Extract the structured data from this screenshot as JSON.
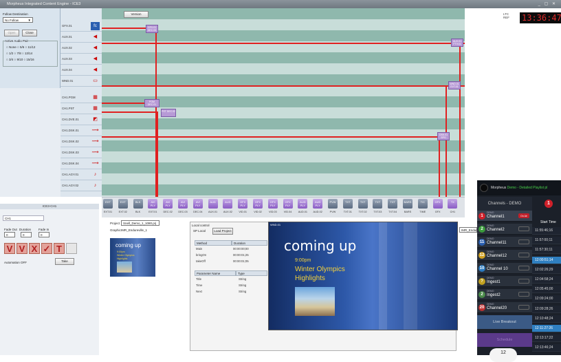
{
  "title_bar": "Morpheus Integrated Content Engine - ICE3",
  "window_buttons": "_ ▢ ✕",
  "follow": {
    "label": "Follow Destination",
    "value": "No Follow",
    "open": "Open",
    "close": "Close"
  },
  "audio_pair": {
    "label": "Active Audio Pair",
    "row1": "○ None ○ 5/6 ○ 11/12",
    "row2": "○ 1/2 ○ 7/8 ○ 13/14",
    "row3": "○ 3/4 ○ 9/10 ○ 15/16"
  },
  "version_button": "Version",
  "timecode": {
    "ltc": "LTC",
    "ref": "REF",
    "value": "13:36:47"
  },
  "rows": [
    {
      "label": "GFX.01",
      "icon": "fc-icon"
    },
    {
      "label": "AUX.01",
      "icon": "audio-icon"
    },
    {
      "label": "AUX.02",
      "icon": "audio-icon"
    },
    {
      "label": "AUX.03",
      "icon": "audio-icon"
    },
    {
      "label": "AUX.04",
      "icon": "audio-icon"
    },
    {
      "label": "WND.01",
      "icon": "window-icon"
    },
    {
      "label": "",
      "icon": ""
    },
    {
      "label": "CH1.PGM",
      "icon": "pgm-icon"
    },
    {
      "label": "CH1.PST",
      "icon": "pst-icon"
    },
    {
      "label": "CH1.DVE.01",
      "icon": "dve-icon"
    },
    {
      "label": "CH1.DSK.01",
      "icon": "key-icon"
    },
    {
      "label": "CH1.DSK.02",
      "icon": "key-icon"
    },
    {
      "label": "CH1.DSK.03",
      "icon": "key-icon"
    },
    {
      "label": "CH1.DSK.04",
      "icon": "key-icon"
    },
    {
      "label": "CH1.AGY.01",
      "icon": "speaker-icon"
    },
    {
      "label": "CH1.AGY.02",
      "icon": "speaker-icon"
    }
  ],
  "events": [
    {
      "label": "GFX.01 DEC.03"
    },
    {
      "label": "AUX.01 FTV.01"
    },
    {
      "label": "WND.01 EVT.01"
    },
    {
      "label": "PGM DEC.01"
    },
    {
      "label": "PST DEC.02"
    },
    {
      "label": "DSK.01 SPG"
    }
  ],
  "toolbar": [
    {
      "icon": "EXT",
      "label": "EXT.01"
    },
    {
      "icon": "EXT",
      "label": "EXT.02"
    },
    {
      "icon": "BLK",
      "label": "BLK"
    },
    {
      "icon": "AVI PLY",
      "label": "EXT.01"
    },
    {
      "icon": "AVI PLY",
      "label": "DEC.02"
    },
    {
      "icon": "AVI PLY",
      "label": "DEC.03"
    },
    {
      "icon": "AVI PLY",
      "label": "DEC.04"
    },
    {
      "icon": "AUD",
      "label": "AUX.01"
    },
    {
      "icon": "AUD",
      "label": "AUX.02"
    },
    {
      "icon": "GFX PLY",
      "label": "VID.01"
    },
    {
      "icon": "GFX PLY",
      "label": "VID.02"
    },
    {
      "icon": "GFX PLY",
      "label": "VID.03"
    },
    {
      "icon": "GFX PLY",
      "label": "VID.04"
    },
    {
      "icon": "AUD PLY",
      "label": "AUD.01"
    },
    {
      "icon": "AUD PLY",
      "label": "AUD.02"
    },
    {
      "icon": "PVW",
      "label": "PVW"
    },
    {
      "icon": "TXT",
      "label": "TXT.01"
    },
    {
      "icon": "TXT",
      "label": "TXT.02"
    },
    {
      "icon": "TXT",
      "label": "TXT.03"
    },
    {
      "icon": "TXT",
      "label": "TXT.04"
    },
    {
      "icon": "BARS",
      "label": "BARS"
    },
    {
      "icon": "T/C",
      "label": "TIME"
    },
    {
      "icon": "GFX",
      "label": "GFX"
    },
    {
      "icon": "TX",
      "label": "CH1"
    }
  ],
  "control": {
    "header": "ICE3-CH1",
    "tab": "CH1",
    "fade_out": "Fade Out",
    "duration": "Duration",
    "fade_in": "Fade In",
    "fade_out_val": "0",
    "duration_val": "0",
    "fade_in_val": "0",
    "automation": "Automation OFF",
    "take": "Take"
  },
  "project": {
    "label": "Project",
    "value": "Snell_Demo_1_1080.prj",
    "graphic_label": "Graphic",
    "graphic_value": "IMR_Endureville_1"
  },
  "preview_text": {
    "line1": "coming up",
    "line2": "9:00pm",
    "line3": "Winter Olympics",
    "line4": "Highlights"
  },
  "local_control": {
    "title": "Local control",
    "sp": "SP Local",
    "load_project": "Load Project",
    "graphic_label": "Graphic",
    "graphic_value": "IMR_Endur",
    "method_header": "Method",
    "duration_header": "Duration",
    "methods": [
      {
        "name": "Main",
        "dur": "00:00:00;00"
      },
      {
        "name": "bringOn",
        "dur": "00:00:01;25"
      },
      {
        "name": "takeOff",
        "dur": "00:00:01;05"
      }
    ],
    "param_header": "Parameter Name",
    "type_header": "Type",
    "params": [
      {
        "name": "Title",
        "type": "String"
      },
      {
        "name": "Time",
        "type": "String"
      },
      {
        "name": "Next",
        "type": "String"
      }
    ],
    "window_title": "WND.01"
  },
  "playlist": {
    "header_prefix": "Morpheus",
    "header_green": "Demo - Detailed Playlist pl",
    "tab": "Channels - DEMO",
    "badge": "1",
    "start_time": "Start Time",
    "channels": [
      {
        "num": "1",
        "name": "Channel1",
        "tag": "On Air",
        "color": "#d0202a"
      },
      {
        "num": "2",
        "name": "Channel2",
        "tag": "",
        "color": "#3a9a3a"
      },
      {
        "num": "11",
        "name": "Channel11",
        "tag": "",
        "color": "#2a5fb0"
      },
      {
        "num": "12",
        "name": "Channel12",
        "tag": "",
        "color": "#d0a020"
      },
      {
        "num": "10",
        "name": "Channel 10",
        "tag": "",
        "color": "#2a7ac0"
      },
      {
        "num": "?",
        "name": "Ingest1",
        "tag": "",
        "color": "#c0a020"
      },
      {
        "num": "2",
        "name": "Ingest2",
        "tag": "",
        "color": "#4a8a4a"
      },
      {
        "num": "20",
        "name": "Channel20",
        "tag": "",
        "color": "#c03030"
      }
    ],
    "demo_label": "DEMO",
    "times": [
      "11:55:46;16",
      "11:57:00;11",
      "11:57:30;11",
      "12:00:51;14",
      "12:02:26;29",
      "12:04:58;24",
      "12:05:45;00",
      "12:09:24;00",
      "12:09:28;26",
      "12:10:48;24",
      "12:11:27:26",
      "12:13:17;22",
      "12:13:46;24"
    ],
    "live_breakout": "Live Breakout",
    "purple_btn": "Schedule",
    "bottom_num": "12"
  },
  "colors": {
    "stripe_dark": "#8fb8ad",
    "stripe_light": "#c8ddd9",
    "line_red": "#e02020",
    "event_purple": "#b79ad6"
  }
}
